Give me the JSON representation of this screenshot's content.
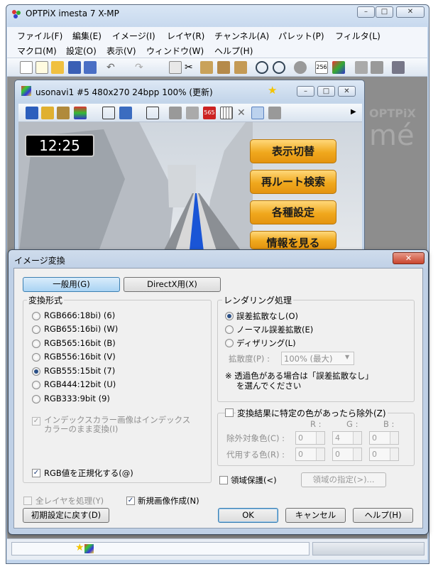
{
  "main_window": {
    "title": "OPTPiX imesta 7 X-MP",
    "controls": {
      "minimize": "–",
      "maximize": "□",
      "close": "✕"
    }
  },
  "menubar": {
    "row1": [
      "ファイル(F)",
      "編集(E)",
      "イメージ(I)",
      "レイヤ(R)",
      "チャンネル(A)",
      "パレット(P)",
      "フィルタ(L)"
    ],
    "row2": [
      "マクロ(M)",
      "設定(O)",
      "表示(V)",
      "ウィンドウ(W)",
      "ヘルプ(H)"
    ]
  },
  "toolbar": {
    "icons": [
      "new-icon",
      "new-multi-icon",
      "open-icon",
      "save-icon",
      "save-all-icon",
      "undo-icon",
      "redo-icon",
      "copy-icon",
      "cut-icon",
      "paste-icon",
      "paste-new-icon",
      "paste-layer-icon",
      "zoom-in-icon",
      "zoom-out-icon",
      "stop-icon",
      "palette-256-icon",
      "color-icon",
      "layer-icon",
      "layer2-icon",
      "settings-icon"
    ],
    "palette_label": "256"
  },
  "child_window": {
    "title": "usonavi1 #5  480x270  24bpp  100% (更新)",
    "toolbar_label": "565",
    "screen": {
      "time": "12:25",
      "buttons": [
        "表示切替",
        "再ルート検索",
        "各種設定",
        "情報を見る"
      ]
    }
  },
  "background_watermark": {
    "text": "OPTPiX",
    "text2": "mé"
  },
  "dialog": {
    "title": "イメージ変換",
    "close": "✕",
    "tabs": [
      {
        "label": "一般用(G)",
        "active": true
      },
      {
        "label": "DirectX用(X)",
        "active": false
      }
    ],
    "format_group": {
      "title": "変換形式",
      "options": [
        {
          "label": "RGB666:18bi) (6)",
          "selected": false
        },
        {
          "label": "RGB655:16bi) (W)",
          "selected": false
        },
        {
          "label": "RGB565:16bit (B)",
          "selected": false
        },
        {
          "label": "RGB556:16bit (V)",
          "selected": false
        },
        {
          "label": "RGB555:15bit (7)",
          "selected": true
        },
        {
          "label": "RGB444:12bit (U)",
          "selected": false
        },
        {
          "label": "RGB333:9bit (9)",
          "selected": false
        }
      ],
      "index_checkbox_line1": "インデックスカラー画像はインデックス",
      "index_checkbox_line2": "カラーのまま変換(I)",
      "normalize_label": "RGB値を正規化する(@)"
    },
    "rendering_group": {
      "title": "レンダリング処理",
      "options": [
        {
          "label": "誤差拡散なし(O)",
          "selected": true
        },
        {
          "label": "ノーマル誤差拡散(E)",
          "selected": false
        },
        {
          "label": "ディザリング(L)",
          "selected": false
        }
      ],
      "spread_label": "拡散度(P) :",
      "spread_value": "100% (最大)",
      "note_line1": "※ 透過色がある場合は「誤差拡散なし」",
      "note_line2": "を選んでください"
    },
    "exclude_group": {
      "checkbox_label": "変換結果に特定の色があったら除外(Z)",
      "headers": [
        "R :",
        "G :",
        "B :"
      ],
      "target_label": "除外対象色(C) :",
      "target_values": [
        "0",
        "4",
        "0"
      ],
      "replace_label": "代用する色(R) :",
      "replace_values": [
        "0",
        "0",
        "0"
      ]
    },
    "region_protect_label": "領域保護(<)",
    "region_button": "領域の指定(>)...",
    "all_layers_label": "全レイヤを処理(Y)",
    "new_image_label": "新規画像作成(N)",
    "reset_button": "初期設定に戻す(D)",
    "ok_button": "OK",
    "cancel_button": "キャンセル",
    "help_button": "ヘルプ(H)"
  }
}
